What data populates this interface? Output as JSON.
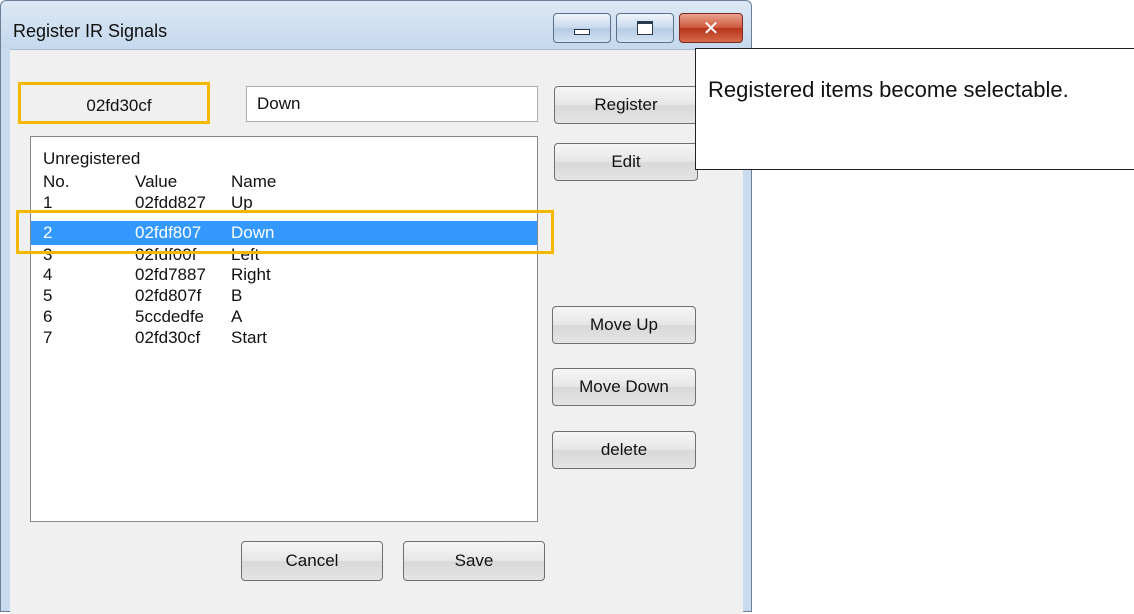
{
  "window": {
    "title": "Register IR Signals",
    "controls": {
      "close_glyph": "✕"
    }
  },
  "form": {
    "signal_code": "02fd30cf",
    "name_value": "Down"
  },
  "buttons": {
    "register": "Register",
    "edit": "Edit",
    "move_up": "Move Up",
    "move_down": "Move Down",
    "delete": "delete",
    "cancel": "Cancel",
    "save": "Save"
  },
  "list": {
    "section_label": "Unregistered",
    "headers": {
      "no": "No.",
      "value": "Value",
      "name": "Name"
    },
    "rows": [
      {
        "no": "1",
        "value": "02fdd827",
        "name": "Up"
      },
      {
        "no": "2",
        "value": "02fdf807",
        "name": "Down"
      },
      {
        "no": "3",
        "value": "02fdf00f",
        "name": "Left"
      },
      {
        "no": "4",
        "value": "02fd7887",
        "name": "Right"
      },
      {
        "no": "5",
        "value": "02fd807f",
        "name": "B"
      },
      {
        "no": "6",
        "value": "5ccdedfe",
        "name": "A"
      },
      {
        "no": "7",
        "value": "02fd30cf",
        "name": "Start"
      }
    ],
    "selected_index": 1
  },
  "callout": {
    "text": "Registered items become selectable."
  },
  "colors": {
    "highlight": "#f5b800",
    "selection": "#3399ff"
  }
}
